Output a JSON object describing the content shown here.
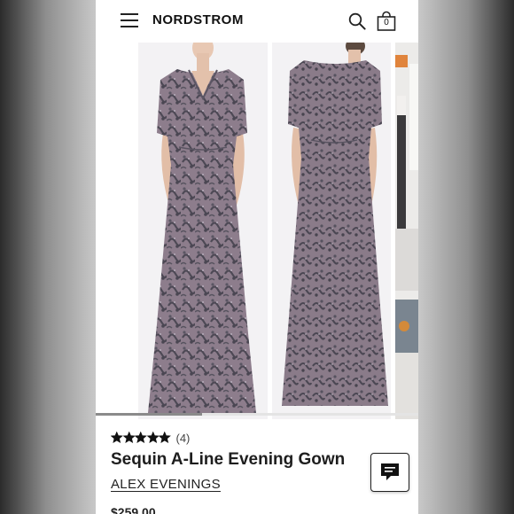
{
  "header": {
    "logo": "NORDSTROM",
    "bag_count": "0"
  },
  "carousel": {
    "progress": 0.33
  },
  "product": {
    "rating": 5,
    "review_count": "(4)",
    "title": "Sequin A-Line Evening Gown",
    "brand": "ALEX EVENINGS",
    "price": "$259.00"
  },
  "colors": {
    "gown_base": "#8e7f8d",
    "sequin": "#4e4a56",
    "accent": "#111111"
  }
}
